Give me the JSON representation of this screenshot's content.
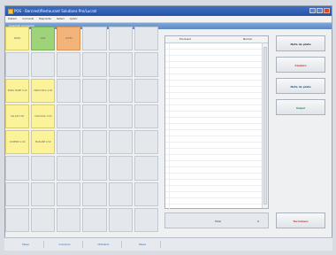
{
  "window": {
    "title": "POS - Barcrest/Restaurant Solutions Pro/Lucrat"
  },
  "menubar": {
    "items": [
      "Sistem",
      "Comenzi",
      "Rapoarte",
      "Setari",
      "Ajutor"
    ]
  },
  "toolstrip": {
    "label": "Selectati produsele"
  },
  "grid": {
    "cells": [
      {
        "label": "PIZZA",
        "color": "yellow"
      },
      {
        "label": "BAR",
        "color": "green"
      },
      {
        "label": "CAFEA",
        "color": "orange"
      },
      {
        "label": "",
        "color": "grey"
      },
      {
        "label": "",
        "color": "grey"
      },
      {
        "label": "",
        "color": "grey"
      },
      {
        "label": "",
        "color": "grey"
      },
      {
        "label": "",
        "color": "grey"
      },
      {
        "label": "",
        "color": "grey"
      },
      {
        "label": "",
        "color": "grey"
      },
      {
        "label": "",
        "color": "grey"
      },
      {
        "label": "",
        "color": "grey"
      },
      {
        "label": "PIZZA MARE 5.00",
        "color": "yellow"
      },
      {
        "label": "PIZZA MICA 4.00",
        "color": "yellow"
      },
      {
        "label": "",
        "color": "grey"
      },
      {
        "label": "",
        "color": "grey"
      },
      {
        "label": "",
        "color": "grey"
      },
      {
        "label": "",
        "color": "grey"
      },
      {
        "label": "SALAM 3.00",
        "color": "yellow"
      },
      {
        "label": "CASCAVAL 3.00",
        "color": "yellow"
      },
      {
        "label": "",
        "color": "grey"
      },
      {
        "label": "",
        "color": "grey"
      },
      {
        "label": "",
        "color": "grey"
      },
      {
        "label": "",
        "color": "grey"
      },
      {
        "label": "CIUPERCI 2.00",
        "color": "yellow"
      },
      {
        "label": "MASLINE 2.00",
        "color": "yellow"
      },
      {
        "label": "",
        "color": "grey"
      },
      {
        "label": "",
        "color": "grey"
      },
      {
        "label": "",
        "color": "grey"
      },
      {
        "label": "",
        "color": "grey"
      },
      {
        "label": "",
        "color": "grey"
      },
      {
        "label": "",
        "color": "grey"
      },
      {
        "label": "",
        "color": "grey"
      },
      {
        "label": "",
        "color": "grey"
      },
      {
        "label": "",
        "color": "grey"
      },
      {
        "label": "",
        "color": "grey"
      },
      {
        "label": "",
        "color": "grey"
      },
      {
        "label": "",
        "color": "grey"
      },
      {
        "label": "",
        "color": "grey"
      },
      {
        "label": "",
        "color": "grey"
      },
      {
        "label": "",
        "color": "grey"
      },
      {
        "label": "",
        "color": "grey"
      },
      {
        "label": "",
        "color": "grey"
      },
      {
        "label": "",
        "color": "grey"
      },
      {
        "label": "",
        "color": "grey"
      },
      {
        "label": "",
        "color": "grey"
      },
      {
        "label": "",
        "color": "grey"
      },
      {
        "label": "",
        "color": "grey"
      }
    ]
  },
  "order_list": {
    "columns": [
      "Produsul",
      "Numar"
    ],
    "rows": 29
  },
  "total": {
    "label": "Total",
    "value": "0"
  },
  "actions": {
    "buttons": [
      {
        "label": "Nota de plata",
        "color": "#333333"
      },
      {
        "label": "Anulare",
        "color": "#c0392b"
      },
      {
        "label": "Nota de plata",
        "color": "#2b4f86"
      },
      {
        "label": "Inapoi",
        "color": "#2e8b57"
      },
      {
        "label": "Terminare",
        "color": "#c0392b"
      }
    ]
  },
  "statusbar": {
    "tabs": [
      "Mese",
      "Comenzi",
      "Utilizator",
      "Mese"
    ]
  },
  "colors": {
    "accent": "#2552a6",
    "yellow_cell": "#fbf29a",
    "green_cell": "#9ed37a",
    "orange_cell": "#f3b47a"
  }
}
